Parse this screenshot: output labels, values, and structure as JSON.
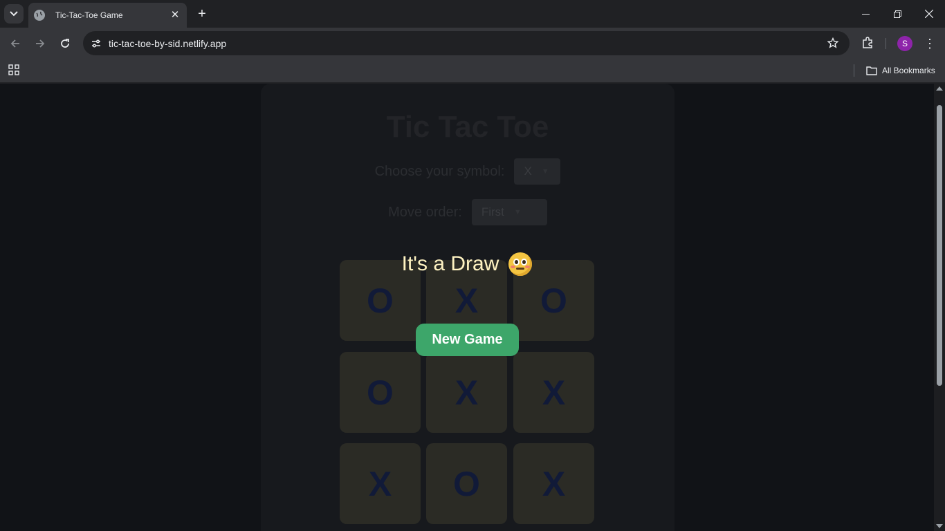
{
  "browser": {
    "tab_title": "Tic-Tac-Toe Game",
    "url": "tic-tac-toe-by-sid.netlify.app",
    "profile_initial": "S",
    "bookmarks_folder": "All Bookmarks"
  },
  "game": {
    "title": "Tic Tac Toe",
    "symbol_label": "Choose your symbol:",
    "symbol_value": "X",
    "order_label": "Move order:",
    "order_value": "First",
    "board": [
      "O",
      "X",
      "O",
      "O",
      "X",
      "X",
      "X",
      "O",
      "X"
    ],
    "result_message": "It's a Draw",
    "result_emoji": "flushed-face-emoji",
    "new_game_label": "New Game"
  },
  "colors": {
    "accent_button": "#3da66a",
    "message_text": "#fff3c2",
    "avatar": "#8e24aa"
  }
}
